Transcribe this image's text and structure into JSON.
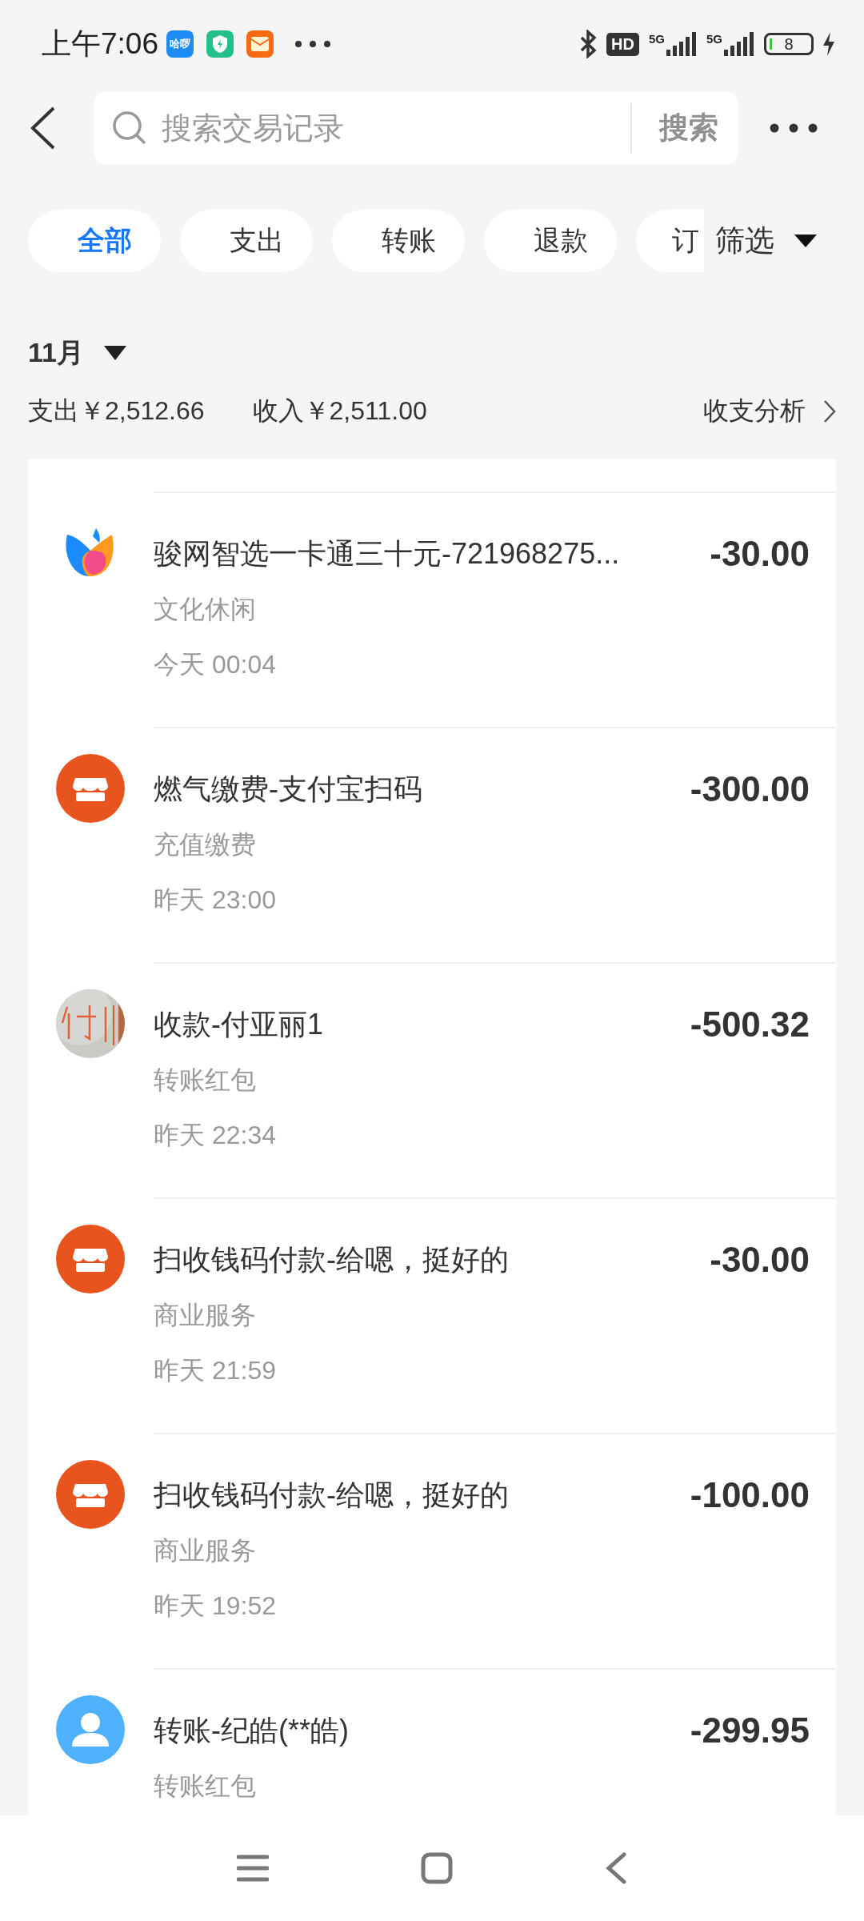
{
  "status_bar": {
    "time": "上午7:06",
    "notifications": [
      {
        "kind": "app",
        "label": "哈啰",
        "color": "#1e8cf5"
      },
      {
        "kind": "shield",
        "color": "#22c08a"
      },
      {
        "kind": "envelope",
        "color": "#f56a12"
      }
    ],
    "hd": "HD",
    "network": [
      "5G",
      "5G"
    ],
    "battery": "8"
  },
  "search": {
    "placeholder": "搜索交易记录",
    "button": "搜索"
  },
  "tabs": [
    {
      "label": "全部",
      "selected": true
    },
    {
      "label": "支出",
      "selected": false
    },
    {
      "label": "转账",
      "selected": false
    },
    {
      "label": "退款",
      "selected": false
    },
    {
      "label": "订",
      "selected": false
    }
  ],
  "filter": "筛选",
  "month": "11月",
  "summary": {
    "expense": "支出￥2,512.66",
    "income": "收入￥2,511.00",
    "analysis": "收支分析"
  },
  "transactions": [
    {
      "kind": "logo",
      "title": "骏网智选一卡通三十元-721968275...",
      "category": "文化休闲",
      "time": "今天 00:04",
      "amount": "-30.00"
    },
    {
      "kind": "store",
      "title": "燃气缴费-支付宝扫码",
      "category": "充值缴费",
      "time": "昨天 23:00",
      "amount": "-300.00"
    },
    {
      "title": "收款-付亚丽1",
      "category": "转账红包",
      "time": "昨天 22:34",
      "amount": "-500.32"
    },
    {
      "kind": "store",
      "title": "扫收钱码付款-给嗯，挺好的",
      "category": "商业服务",
      "time": "昨天 21:59",
      "amount": "-30.00"
    },
    {
      "kind": "store",
      "title": "扫收钱码付款-给嗯，挺好的",
      "category": "商业服务",
      "time": "昨天 19:52",
      "amount": "-100.00"
    },
    {
      "kind": "person",
      "title": "转账-纪皓(**皓)",
      "category": "转账红包",
      "amount": "-299.95"
    }
  ]
}
